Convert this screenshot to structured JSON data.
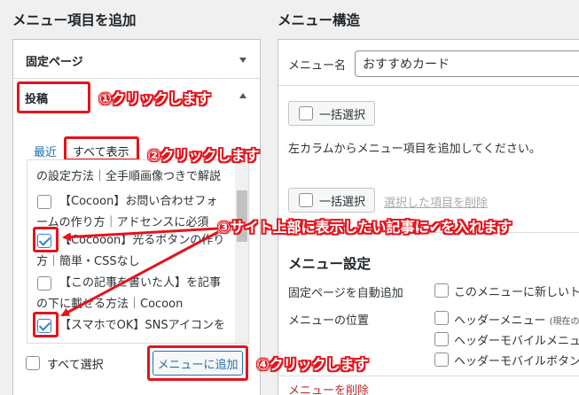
{
  "left": {
    "heading": "メニュー項目を追加",
    "fixed_page": "固定ページ",
    "posts": "投稿",
    "tab_recent": "最近",
    "tab_all": "すべて表示",
    "list_lines": [
      "の設定方法｜全手順画像つきで解説",
      "【Cocoon】お問い合わせフォ",
      "ームの作り方｜アドセンスに必須",
      "【Cocooon】光るボタンの作り",
      "方｜簡単・CSSなし",
      "【この記事を書いた人】を記事",
      "の下に載せる方法｜Cocoon",
      "【スマホでOK】SNSアイコンを"
    ],
    "select_all": "すべて選択",
    "add_button": "メニューに追加"
  },
  "annotations": {
    "step1": "①クリックします",
    "step2": "②クリックします",
    "step3": "③サイト上部に表示したい記事に✔を入れます",
    "step4": "④クリックします"
  },
  "right": {
    "heading": "メニュー構造",
    "menu_name_label": "メニュー名",
    "menu_name_value": "おすすめカード",
    "bulk_select": "一括選択",
    "instruction": "左カラムからメニュー項目を追加してください。",
    "delete_selected": "選択した項目を削除",
    "settings_heading": "メニュー設定",
    "auto_add_label": "固定ページを自動追加",
    "auto_add_option": "このメニューに新しいト",
    "location_label": "メニューの位置",
    "locations": [
      "ヘッダーメニュー",
      "ヘッダーモバイルメニュ",
      "ヘッダーモバイルボタン"
    ],
    "location_note": "(現在の",
    "delete_menu": "メニューを削除"
  },
  "colors": {
    "annotation_red": "#e3141c",
    "link_blue": "#2271b1",
    "delete_red": "#b32d2e"
  }
}
